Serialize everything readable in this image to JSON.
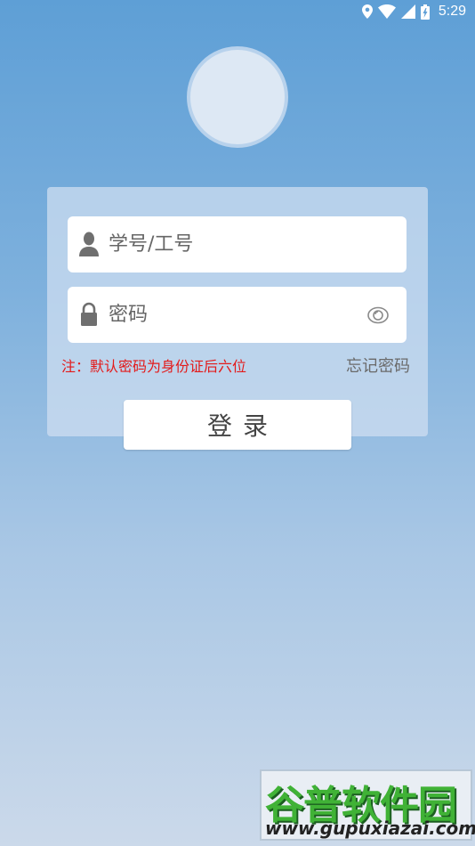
{
  "status_bar": {
    "time": "5:29",
    "icons": [
      "location-icon",
      "wifi-icon",
      "signal-icon",
      "battery-icon"
    ]
  },
  "login": {
    "username_placeholder": "学号/工号",
    "password_placeholder": "密码",
    "note": "注：默认密码为身份证后六位",
    "forgot_label": "忘记密码",
    "login_label": "登录"
  },
  "watermark": {
    "title": "谷普软件园",
    "url": "www.gupuxiazai.com"
  },
  "colors": {
    "note": "#e31a1a",
    "background_top": "#5e9fd6",
    "background_bottom": "#cbd9ea"
  }
}
